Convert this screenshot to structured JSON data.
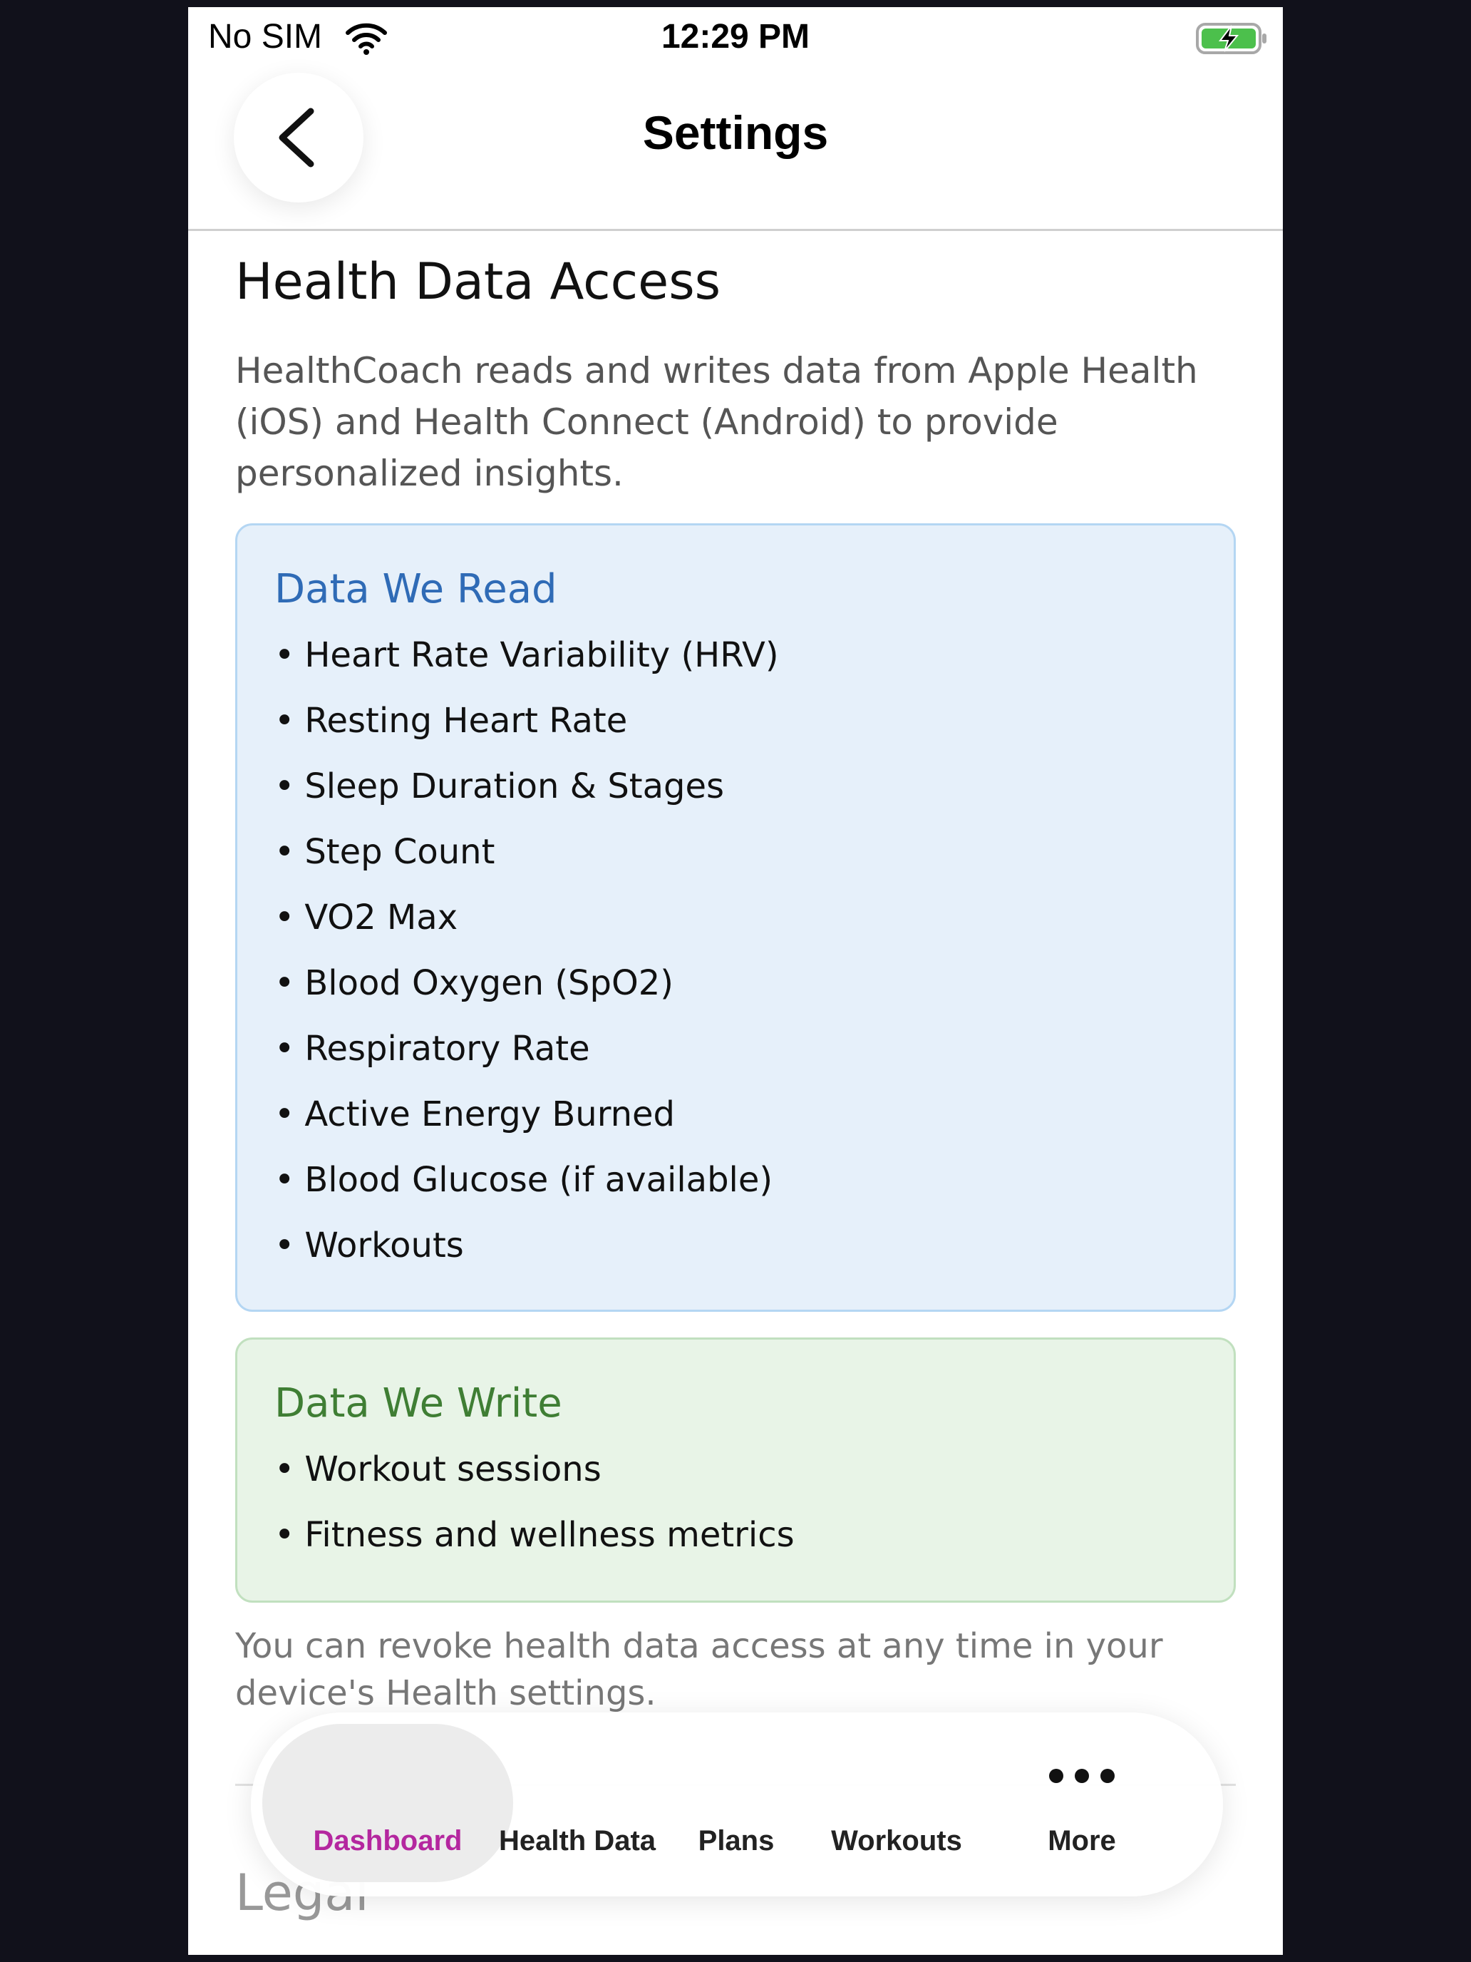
{
  "status_bar": {
    "carrier": "No SIM",
    "time": "12:29 PM",
    "icons": [
      "wifi-icon",
      "battery-charging-icon"
    ]
  },
  "header": {
    "title": "Settings",
    "back_icon": "chevron-left-icon"
  },
  "health_section": {
    "title": "Health Data Access",
    "description": "HealthCoach reads and writes data from Apple Health (iOS) and Health Connect (Android) to provide personalized insights.",
    "read_card": {
      "title": "Data We Read",
      "items": [
        "Heart Rate Variability (HRV)",
        "Resting Heart Rate",
        "Sleep Duration & Stages",
        "Step Count",
        "VO2 Max",
        "Blood Oxygen (SpO2)",
        "Respiratory Rate",
        "Active Energy Burned",
        "Blood Glucose (if available)",
        "Workouts"
      ]
    },
    "write_card": {
      "title": "Data We Write",
      "items": [
        "Workout sessions",
        "Fitness and wellness metrics"
      ]
    },
    "footer_note": "You can revoke health data access at any time in your device's Health settings."
  },
  "legal_section": {
    "title": "Legal"
  },
  "tab_bar": {
    "items": [
      {
        "label": "Dashboard",
        "active": true
      },
      {
        "label": "Health Data",
        "active": false
      },
      {
        "label": "Plans",
        "active": false
      },
      {
        "label": "Workouts",
        "active": false
      },
      {
        "label": "More",
        "active": false,
        "icon": "more-dots-icon"
      }
    ]
  },
  "colors": {
    "read_accent": "#2f6bb6",
    "read_background": "#e6f0fa",
    "write_accent": "#3f7e34",
    "write_background": "#e8f4e7",
    "tab_active": "#b4279f"
  }
}
